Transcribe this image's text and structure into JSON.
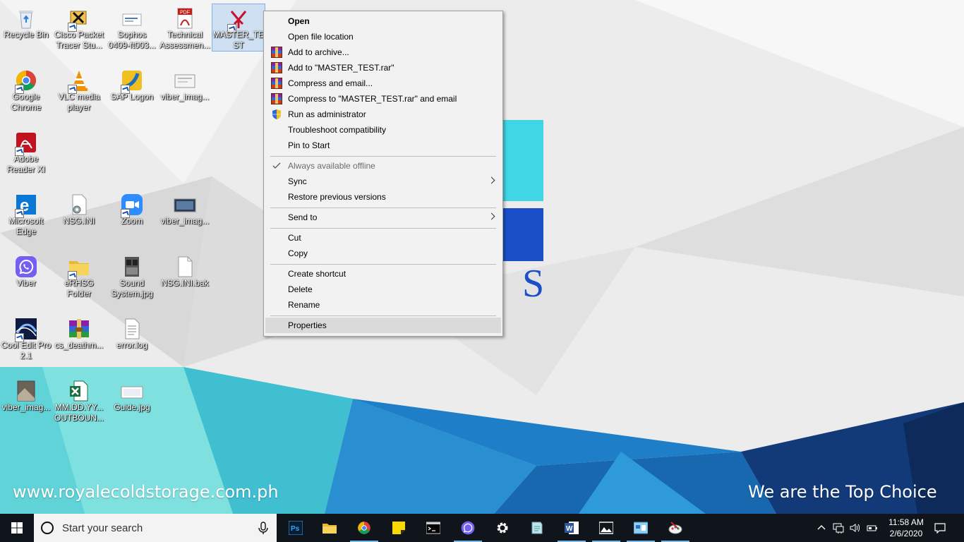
{
  "desktop": {
    "icons": [
      {
        "label": "Recycle Bin",
        "icon": "recycle-bin-icon"
      },
      {
        "label": "Cisco Packet Tracer Stu...",
        "icon": "cisco-packet-tracer-icon"
      },
      {
        "label": "Sophos 0409-ft003...",
        "icon": "document-icon"
      },
      {
        "label": "Technical Assessmen...",
        "icon": "pdf-icon"
      },
      {
        "label": "MASTER_TEST",
        "icon": "master-test-icon"
      },
      {
        "label": "Google Chrome",
        "icon": "chrome-icon"
      },
      {
        "label": "VLC media player",
        "icon": "vlc-icon"
      },
      {
        "label": "SAP Logon",
        "icon": "sap-logon-icon"
      },
      {
        "label": "viber_imag...",
        "icon": "image-file-icon"
      },
      {
        "label": "Adobe Reader XI",
        "icon": "adobe-reader-icon"
      },
      {
        "label": "Microsoft Edge",
        "icon": "edge-icon"
      },
      {
        "label": "NSG.INI",
        "icon": "ini-file-icon"
      },
      {
        "label": "Zoom",
        "icon": "zoom-icon"
      },
      {
        "label": "viber_imag...",
        "icon": "image-file-icon"
      },
      {
        "label": "Viber",
        "icon": "viber-icon"
      },
      {
        "label": "eRHSG Folder",
        "icon": "folder-icon"
      },
      {
        "label": "Sound System.jpg",
        "icon": "image-file-icon"
      },
      {
        "label": "NSG.INI.bak",
        "icon": "blank-file-icon"
      },
      {
        "label": "Cool Edit Pro 2.1",
        "icon": "cool-edit-icon"
      },
      {
        "label": "cs_deathm...",
        "icon": "winrar-icon"
      },
      {
        "label": "error.log",
        "icon": "text-file-icon"
      },
      {
        "label": "viber_imag...",
        "icon": "image-file-icon"
      },
      {
        "label": "MM.DD.YY... OUTBOUN...",
        "icon": "excel-file-icon"
      },
      {
        "label": "Guide.jpg",
        "icon": "image-file-icon"
      }
    ]
  },
  "wallpaper": {
    "url_text": "www.royalecoldstorage.com.ph",
    "slogan": "We are the Top Choice"
  },
  "context_menu": {
    "items": [
      {
        "label": "Open"
      },
      {
        "label": "Open file location"
      },
      {
        "label": "Add to archive..."
      },
      {
        "label": "Add to \"MASTER_TEST.rar\""
      },
      {
        "label": "Compress and email..."
      },
      {
        "label": "Compress to \"MASTER_TEST.rar\" and email"
      },
      {
        "label": "Run as administrator"
      },
      {
        "label": "Troubleshoot compatibility"
      },
      {
        "label": "Pin to Start"
      },
      {
        "label": "Always available offline"
      },
      {
        "label": "Sync"
      },
      {
        "label": "Restore previous versions"
      },
      {
        "label": "Send to"
      },
      {
        "label": "Cut"
      },
      {
        "label": "Copy"
      },
      {
        "label": "Create shortcut"
      },
      {
        "label": "Delete"
      },
      {
        "label": "Rename"
      },
      {
        "label": "Properties"
      }
    ]
  },
  "taskbar": {
    "search_placeholder": "Start your search",
    "pinned": [
      {
        "name": "photoshop"
      },
      {
        "name": "file-explorer"
      },
      {
        "name": "chrome"
      },
      {
        "name": "sticky-notes"
      },
      {
        "name": "command-prompt"
      },
      {
        "name": "viber"
      },
      {
        "name": "settings"
      },
      {
        "name": "notepad"
      },
      {
        "name": "word"
      },
      {
        "name": "photos"
      },
      {
        "name": "control-panel"
      },
      {
        "name": "paint"
      }
    ],
    "clock_time": "11:58 AM",
    "clock_date": "2/6/2020"
  }
}
